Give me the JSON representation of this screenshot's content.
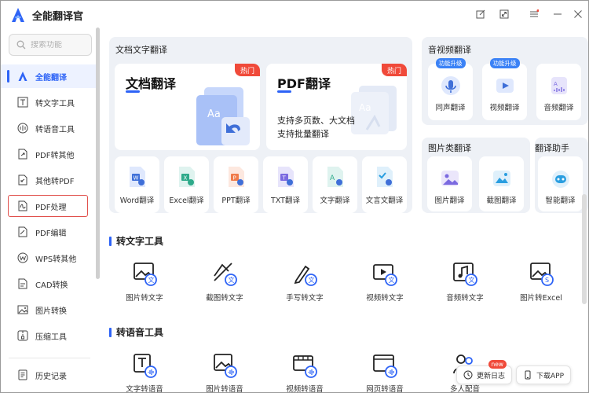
{
  "app": {
    "title": "全能翻译官",
    "accent": "#2d63f6",
    "hot_color": "#f04a3a"
  },
  "search": {
    "placeholder": "搜索功能"
  },
  "sidebar": {
    "items": [
      {
        "label": "全能翻译",
        "icon": "home-a-icon",
        "active": true
      },
      {
        "label": "转文字工具",
        "icon": "text-t-icon"
      },
      {
        "label": "转语音工具",
        "icon": "voice-icon"
      },
      {
        "label": "PDF转其他",
        "icon": "pdf-export-icon"
      },
      {
        "label": "其他转PDF",
        "icon": "pdf-import-icon"
      },
      {
        "label": "PDF处理",
        "icon": "pdf-process-icon",
        "highlighted": true
      },
      {
        "label": "PDF编辑",
        "icon": "pdf-edit-icon"
      },
      {
        "label": "WPS转其他",
        "icon": "wps-icon"
      },
      {
        "label": "CAD转换",
        "icon": "cad-icon"
      },
      {
        "label": "图片转换",
        "icon": "image-convert-icon"
      },
      {
        "label": "压缩工具",
        "icon": "compress-icon"
      }
    ],
    "history": {
      "label": "历史记录",
      "icon": "history-icon"
    }
  },
  "doc_panel": {
    "title": "文档文字翻译",
    "doc_card": {
      "title": "文档翻译",
      "badge": "热门"
    },
    "pdf_card": {
      "title": "PDF翻译",
      "badge": "热门",
      "desc_line1": "支持多页数、大文档",
      "desc_line2": "支持批量翻译"
    },
    "tools": [
      {
        "label": "Word翻译",
        "icon": "word-doc-icon"
      },
      {
        "label": "Excel翻译",
        "icon": "excel-doc-icon"
      },
      {
        "label": "PPT翻译",
        "icon": "ppt-doc-icon"
      },
      {
        "label": "TXT翻译",
        "icon": "txt-doc-icon"
      },
      {
        "label": "文字翻译",
        "icon": "text-doc-icon"
      },
      {
        "label": "文言文翻译",
        "icon": "classical-doc-icon"
      }
    ]
  },
  "av_panel": {
    "title": "音视频翻译",
    "items": [
      {
        "label": "同声翻译",
        "badge": "功能升级",
        "icon": "simultaneous-icon"
      },
      {
        "label": "视频翻译",
        "badge": "功能升级",
        "icon": "video-icon"
      },
      {
        "label": "音频翻译",
        "badge": "",
        "icon": "audio-icon"
      }
    ]
  },
  "image_panel": {
    "title": "图片类翻译",
    "items": [
      {
        "label": "图片翻译",
        "icon": "picture-icon"
      },
      {
        "label": "截图翻译",
        "icon": "screenshot-icon"
      }
    ]
  },
  "assistant_panel": {
    "title": "翻译助手",
    "items": [
      {
        "label": "智能翻译",
        "icon": "robot-icon"
      }
    ]
  },
  "text_tools": {
    "title": "转文字工具",
    "items": [
      {
        "label": "图片转文字",
        "icon": "image-to-text-icon"
      },
      {
        "label": "截图转文字",
        "icon": "screenshot-to-text-icon"
      },
      {
        "label": "手写转文字",
        "icon": "handwriting-to-text-icon"
      },
      {
        "label": "视频转文字",
        "icon": "video-to-text-icon"
      },
      {
        "label": "音频转文字",
        "icon": "audio-to-text-icon"
      },
      {
        "label": "图片转Excel",
        "icon": "image-to-excel-icon"
      }
    ]
  },
  "voice_tools": {
    "title": "转语音工具",
    "items": [
      {
        "label": "文字转语音",
        "icon": "text-to-voice-icon"
      },
      {
        "label": "图片转语音",
        "icon": "image-to-voice-icon"
      },
      {
        "label": "视频转语音",
        "icon": "video-to-voice-icon"
      },
      {
        "label": "网页转语音",
        "icon": "web-to-voice-icon"
      },
      {
        "label": "多人配音",
        "icon": "multi-dubbing-icon"
      }
    ]
  },
  "floating": {
    "changelog": {
      "label": "更新日志",
      "badge": "new"
    },
    "download": {
      "label": "下载APP"
    }
  }
}
